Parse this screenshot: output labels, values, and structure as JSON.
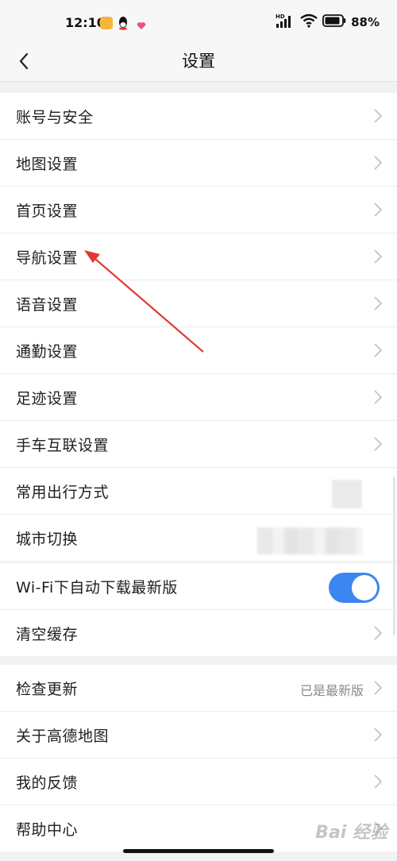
{
  "status_bar": {
    "time": "12:10",
    "network_label": "HD",
    "battery": "88%",
    "icons": [
      "notification-app-icon",
      "qq-icon",
      "heart-icon",
      "signal-icon",
      "wifi-icon",
      "battery-icon"
    ]
  },
  "nav": {
    "title": "设置",
    "back_icon": "chevron-left-icon"
  },
  "groups": [
    {
      "items": [
        {
          "label": "账号与安全"
        },
        {
          "label": "地图设置"
        },
        {
          "label": "首页设置"
        },
        {
          "label": "导航设置"
        },
        {
          "label": "语音设置"
        },
        {
          "label": "通勤设置"
        },
        {
          "label": "足迹设置"
        },
        {
          "label": "手车互联设置"
        },
        {
          "label": "常用出行方式"
        },
        {
          "label": "城市切换"
        }
      ]
    },
    {
      "items": [
        {
          "label": "Wi-Fi下自动下载最新版",
          "toggle_on": true
        },
        {
          "label": "清空缓存"
        }
      ]
    },
    {
      "items": [
        {
          "label": "检查更新",
          "value": "已是最新版"
        },
        {
          "label": "关于高德地图"
        },
        {
          "label": "我的反馈"
        },
        {
          "label": "帮助中心"
        }
      ]
    }
  ],
  "colors": {
    "accent": "#3b86f0",
    "annotation_arrow": "#e03a2f",
    "background": "#f2f2f4"
  },
  "watermark": "Bai 经验"
}
